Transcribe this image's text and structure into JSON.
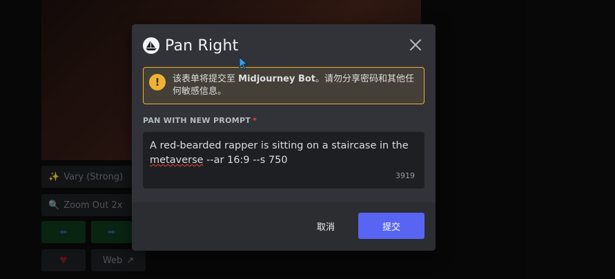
{
  "background": {
    "buttons": {
      "vary_strong": "Vary (Strong)",
      "zoom_out": "Zoom Out 2x",
      "web": "Web"
    }
  },
  "modal": {
    "title": "Pan Right",
    "warning_prefix": "该表单将提交至 ",
    "warning_bot": "Midjourney Bot",
    "warning_suffix": "。请勿分享密码和其他任何敏感信息。",
    "field_label": "PAN WITH NEW PROMPT",
    "required_mark": "*",
    "prompt_line1": "A red-bearded rapper is sitting on a staircase in the",
    "prompt_spell": "metaverse",
    "prompt_rest": " --ar 16:9 --s 750",
    "char_count": "3919",
    "cancel_label": "取消",
    "submit_label": "提交"
  },
  "colors": {
    "accent": "#5865f2",
    "warning": "#f0b232",
    "required": "#f23f43"
  }
}
